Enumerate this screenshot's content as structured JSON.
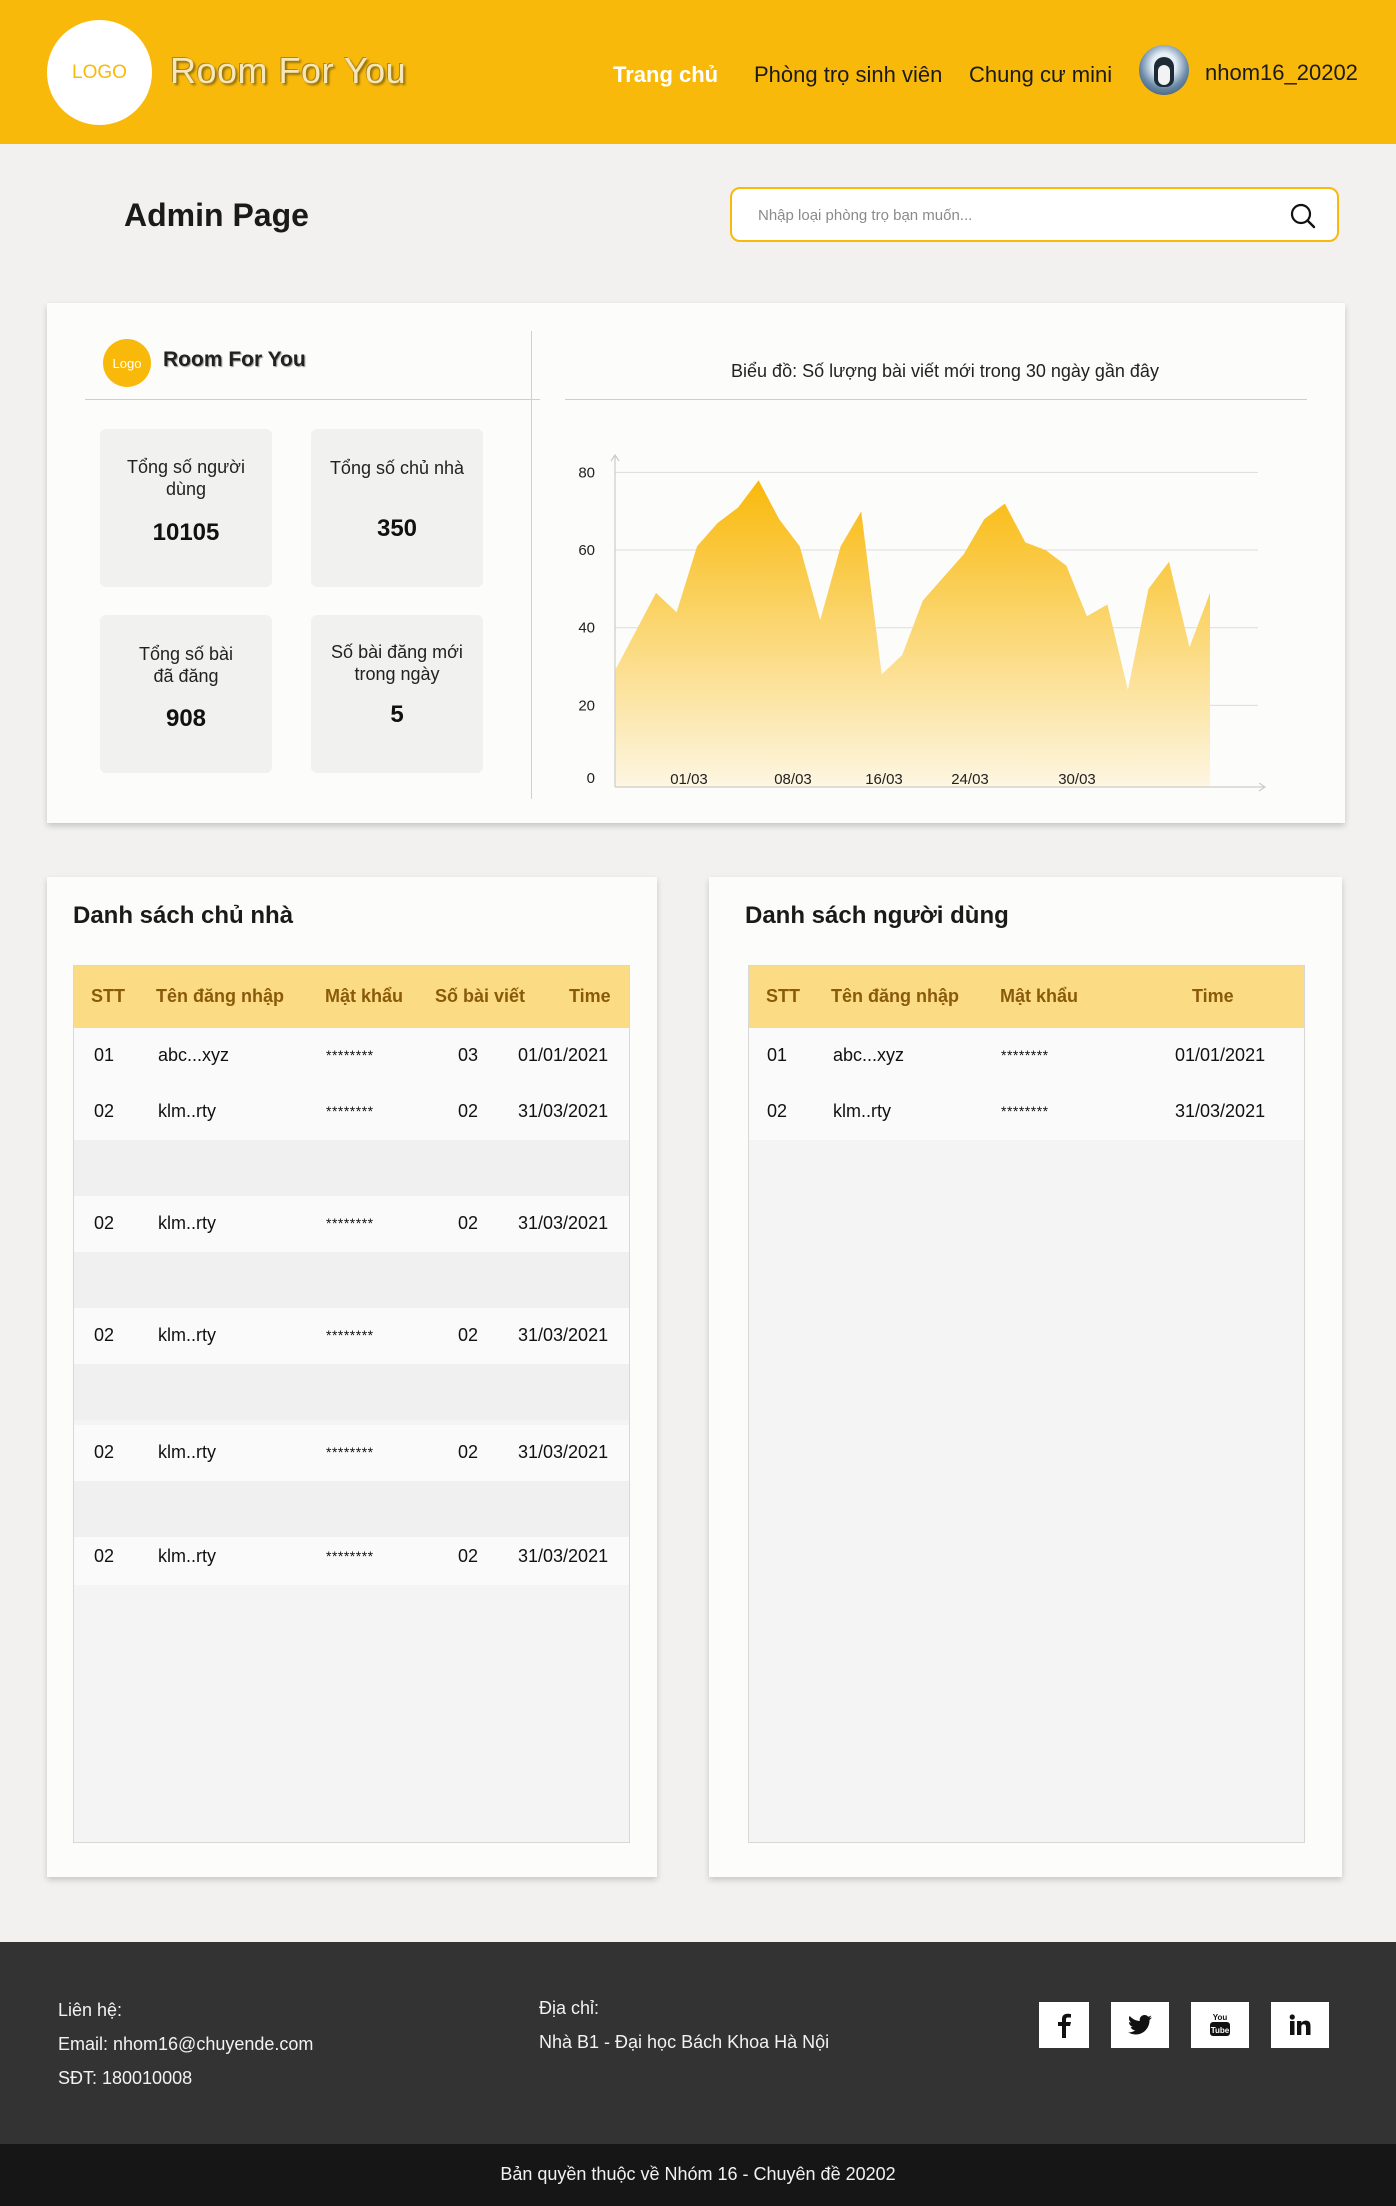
{
  "header": {
    "logo_text": "LOGO",
    "brand": "Room For You",
    "nav": [
      "Trang chủ",
      "Phòng trọ sinh viên",
      "Chung cư mini"
    ],
    "username": "nhom16_20202"
  },
  "page": {
    "title": "Admin Page",
    "search_placeholder": "Nhập loại phòng trọ bạn muốn..."
  },
  "stats": {
    "logo_text": "Logo",
    "brand": "Room For You",
    "cards": [
      {
        "label": "Tổng số người dùng",
        "value": "10105"
      },
      {
        "label": "Tổng số chủ nhà",
        "value": "350"
      },
      {
        "label": "Tổng số bài đã đăng",
        "value": "908"
      },
      {
        "label": "Số bài đăng mới trong ngày",
        "value": "5"
      }
    ]
  },
  "chart_data": {
    "type": "area",
    "title": "Biểu đồ: Số lượng bài viết mới trong 30 ngày gần đây",
    "xlabel": "",
    "ylabel": "",
    "ylim": [
      0,
      85
    ],
    "y_ticks": [
      0,
      20,
      40,
      60,
      80
    ],
    "x_ticks": [
      "01/03",
      "08/03",
      "16/03",
      "24/03",
      "30/03"
    ],
    "grid": true,
    "color": "#f9b90b",
    "series": [
      {
        "values": [
          30,
          40,
          50,
          45,
          62,
          68,
          72,
          79,
          69,
          62,
          43,
          62,
          71,
          29,
          34,
          48,
          54,
          60,
          69,
          73,
          63,
          61,
          57,
          44,
          47,
          25,
          51,
          58,
          36,
          50
        ]
      }
    ]
  },
  "landlords": {
    "title": "Danh sách chủ nhà",
    "columns": [
      "STT",
      "Tên đăng nhập",
      "Mật khẩu",
      "Số bài viết",
      "Time"
    ],
    "rows": [
      [
        "01",
        "abc...xyz",
        "********",
        "03",
        "01/01/2021"
      ],
      [
        "02",
        "klm..rty",
        "********",
        "02",
        "31/03/2021"
      ],
      [
        "02",
        "klm..rty",
        "********",
        "02",
        "31/03/2021"
      ],
      [
        "02",
        "klm..rty",
        "********",
        "02",
        "31/03/2021"
      ],
      [
        "02",
        "klm..rty",
        "********",
        "02",
        "31/03/2021"
      ],
      [
        "02",
        "klm..rty",
        "********",
        "02",
        "31/03/2021"
      ]
    ]
  },
  "users": {
    "title": "Danh sách người dùng",
    "columns": [
      "STT",
      "Tên đăng nhập",
      "Mật khẩu",
      "Time"
    ],
    "rows": [
      [
        "01",
        "abc...xyz",
        "********",
        "01/01/2021"
      ],
      [
        "02",
        "klm..rty",
        "********",
        "31/03/2021"
      ]
    ]
  },
  "footer": {
    "contact_label": "Liên hệ:",
    "email": "Email: nhom16@chuyende.com",
    "phone": "SĐT: 180010008",
    "address_label": "Địa chỉ:",
    "address": "Nhà B1 - Đại học Bách Khoa Hà Nội",
    "copyright": "Bản quyền thuộc về Nhóm 16 - Chuyên đề 20202"
  }
}
